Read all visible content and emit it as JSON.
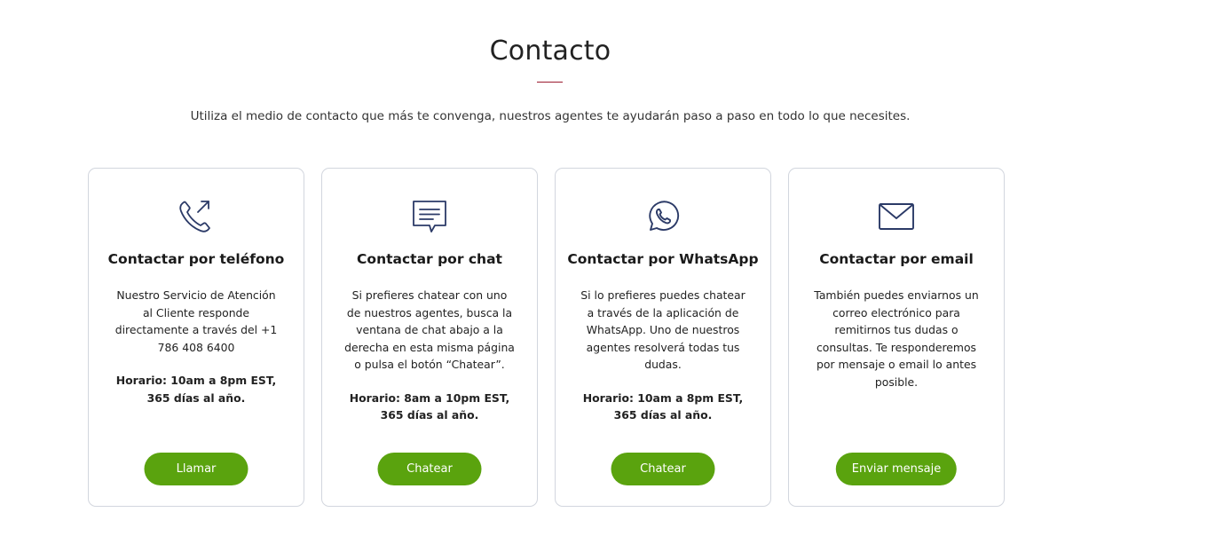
{
  "header": {
    "title": "Contacto",
    "intro": "Utiliza el medio de contacto que más te convenga, nuestros agentes te ayudarán paso a paso en todo lo que necesites."
  },
  "colors": {
    "accent_rule": "#9b1b30",
    "button_green": "#5aa30e",
    "icon_navy": "#2b3a67",
    "card_border": "#d2d6de"
  },
  "cards": [
    {
      "icon": "phone-outgoing-icon",
      "title": "Contactar por teléfono",
      "description": "Nuestro Servicio de Atención al Cliente responde directamente a través del +1 786 408 6400",
      "hours": "Horario: 10am a 8pm EST, 365 días al año.",
      "button": "Llamar"
    },
    {
      "icon": "chat-bubble-icon",
      "title": "Contactar por chat",
      "description": "Si prefieres chatear con uno de nuestros agentes, busca la ventana de chat abajo a la derecha en esta misma página o pulsa el botón “Chatear”.",
      "hours": "Horario: 8am a 10pm EST, 365 días al año.",
      "button": "Chatear"
    },
    {
      "icon": "whatsapp-icon",
      "title": "Contactar por WhatsApp",
      "description": "Si lo prefieres puedes chatear a través de la aplicación de WhatsApp. Uno de nuestros agentes resolverá todas tus dudas.",
      "hours": "Horario: 10am a 8pm EST, 365 días al año.",
      "button": "Chatear"
    },
    {
      "icon": "envelope-icon",
      "title": "Contactar por email",
      "description": "También puedes enviarnos un correo electrónico para remitirnos tus dudas o consultas. Te responderemos por mensaje o email lo antes posible.",
      "hours": "",
      "button": "Enviar mensaje"
    }
  ]
}
